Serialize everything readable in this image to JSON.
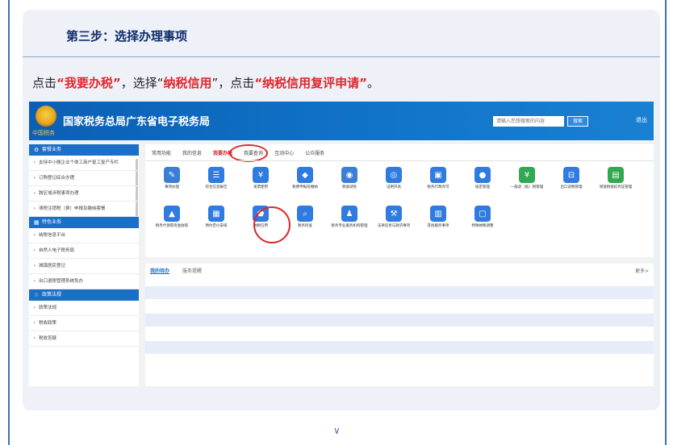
{
  "step_title": "第三步：选择办理事项",
  "instruction": {
    "part1": "点击",
    "q1": "“我要办税”",
    "part2": "，选择“",
    "q2": "纳税信用",
    "part3": "”，点击",
    "q3": "“纳税信用复评申请”",
    "end": "。"
  },
  "site": {
    "name": "国家税务总局广东省电子税务局",
    "emblem_text": "中国税务",
    "search_placeholder": "请输入您想搜索的内容",
    "search_button": "搜索",
    "logout": "退出"
  },
  "sidebar": {
    "sections": [
      {
        "title": "套餐业务",
        "icon": "gear-icon",
        "items": [
          "支持中小微企业个体工商户复工复产专栏",
          "订购登记综合办理",
          "跨区域涉税事项办理",
          "清税注销税（费）申报及缴纳套餐"
        ]
      },
      {
        "title": "特色业务",
        "icon": "grid-icon",
        "items": [
          "纳税信息平台",
          "自然人电子税务局",
          "城镇居民登记",
          "出口退税管理系统免办"
        ]
      },
      {
        "title": "政策法规",
        "icon": "star-icon",
        "items": [
          "政策法规",
          "税收政策",
          "税收答疑"
        ]
      }
    ]
  },
  "tabs": [
    "常用功能",
    "我的信息",
    "我要办税",
    "我要查询",
    "互动中心",
    "公众服务"
  ],
  "active_tab": "我要办税",
  "services": [
    {
      "label": "事项办理",
      "icon": "pen-icon",
      "color": "#3a7fd5"
    },
    {
      "label": "综合信息报告",
      "icon": "doc-icon",
      "color": "#2f7be0"
    },
    {
      "label": "发票使用",
      "icon": "invoice-icon",
      "color": "#2f7be0"
    },
    {
      "label": "税费申报及缴纳",
      "icon": "declare-icon",
      "color": "#2f7be0"
    },
    {
      "label": "税收减免",
      "icon": "coins-icon",
      "color": "#3a7fd5"
    },
    {
      "label": "证明开具",
      "icon": "camera-icon",
      "color": "#2f7be0"
    },
    {
      "label": "税务行政许可",
      "icon": "id-card-icon",
      "color": "#2f7be0"
    },
    {
      "label": "核定管理",
      "icon": "person-icon",
      "color": "#2f7be0"
    },
    {
      "label": "一般退（抵）税管理",
      "icon": "refund-icon",
      "color": "#33a852"
    },
    {
      "label": "出口退税管理",
      "icon": "export-icon",
      "color": "#2f7be0"
    },
    {
      "label": "增值税抵扣凭证管理",
      "icon": "ledger-icon",
      "color": "#33a852"
    },
    {
      "label": "税务代保管资金收取",
      "icon": "bag-icon",
      "color": "#2f7be0"
    },
    {
      "label": "预约定价安排",
      "icon": "calendar-icon",
      "color": "#2f7be0"
    },
    {
      "label": "纳税信用",
      "icon": "shield-icon",
      "color": "#2f7be0"
    },
    {
      "label": "税务检查",
      "icon": "magnify-doc-icon",
      "color": "#2f7be0"
    },
    {
      "label": "税务专业服务机构管理",
      "icon": "agent-icon",
      "color": "#2f7be0"
    },
    {
      "label": "法律追责与救济事项",
      "icon": "gavel-icon",
      "color": "#2f7be0"
    },
    {
      "label": "其他服务事项",
      "icon": "clipboard-icon",
      "color": "#2f7be0"
    },
    {
      "label": "特殊纳税调整",
      "icon": "user-card-icon",
      "color": "#2f7be0"
    }
  ],
  "todo_tabs": [
    "我的待办",
    "服务提醒"
  ],
  "more": "更多>",
  "chevron": "∨"
}
